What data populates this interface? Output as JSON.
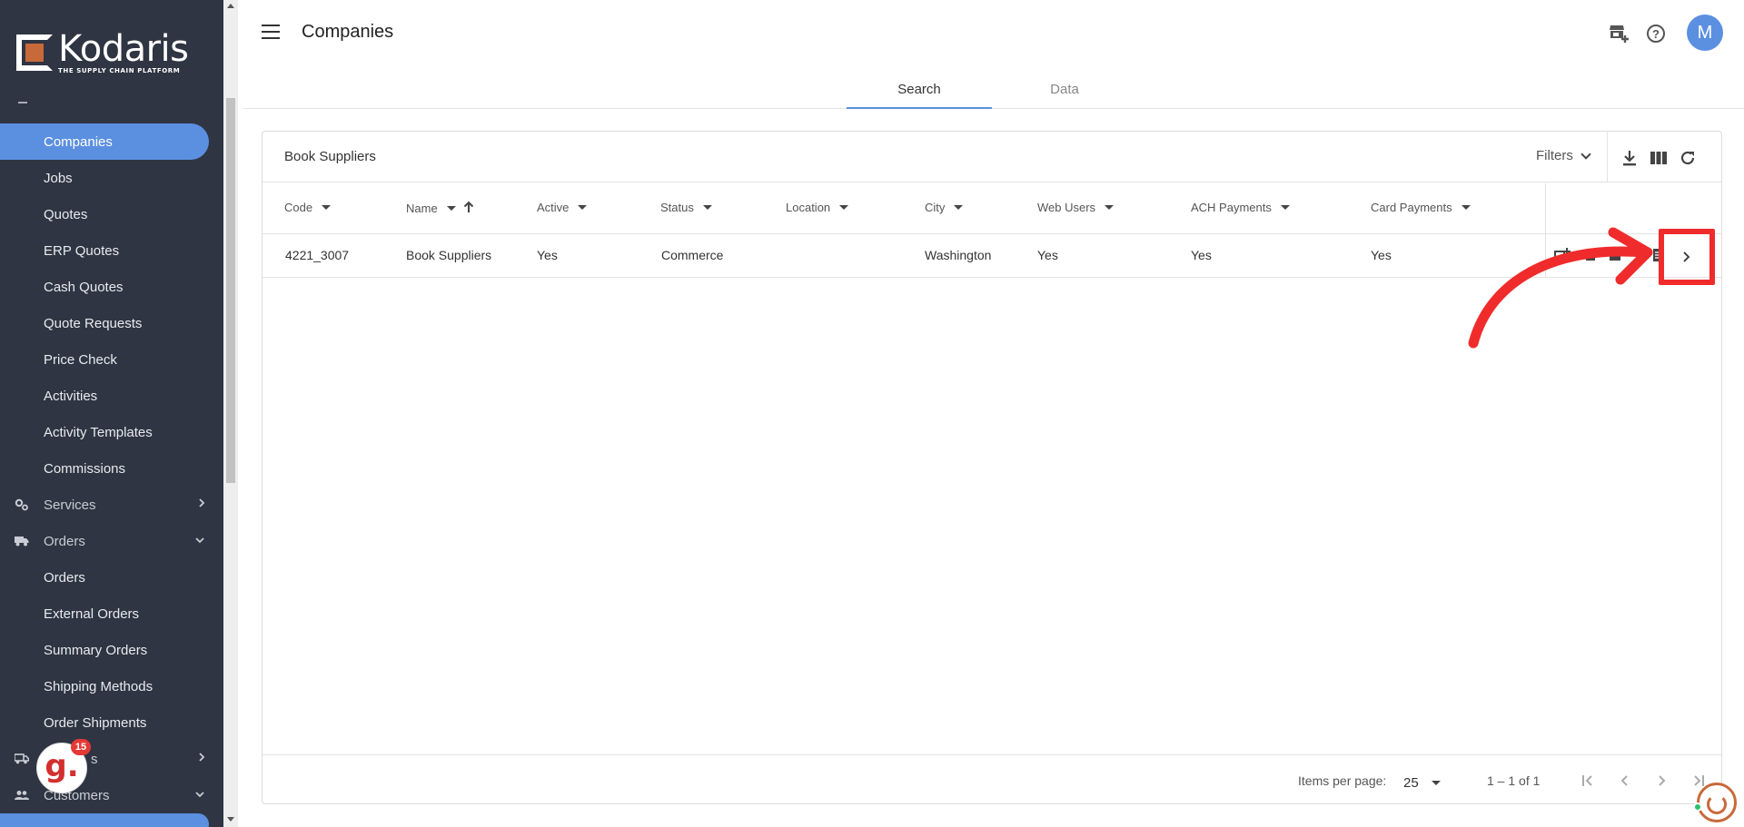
{
  "brand": {
    "name": "Kodaris",
    "tagline": "THE SUPPLY CHAIN PLATFORM"
  },
  "sidebar": {
    "items": [
      {
        "label": "Companies",
        "active": true
      },
      {
        "label": "Jobs"
      },
      {
        "label": "Quotes"
      },
      {
        "label": "ERP Quotes"
      },
      {
        "label": "Cash Quotes"
      },
      {
        "label": "Quote Requests"
      },
      {
        "label": "Price Check"
      },
      {
        "label": "Activities"
      },
      {
        "label": "Activity Templates"
      },
      {
        "label": "Commissions"
      }
    ],
    "services_group": {
      "label": "Services",
      "icon": "gears-icon"
    },
    "orders_group": {
      "label": "Orders",
      "icon": "truck-icon"
    },
    "orders_items": [
      {
        "label": "Orders"
      },
      {
        "label": "External Orders"
      },
      {
        "label": "Summary Orders"
      },
      {
        "label": "Shipping Methods"
      },
      {
        "label": "Order Shipments"
      }
    ],
    "partial_group": {
      "label": "s",
      "icon": "truck-icon"
    },
    "customers_group": {
      "label": "Customers",
      "icon": "people-icon"
    }
  },
  "header": {
    "title": "Companies",
    "avatar_initial": "M",
    "tabs": [
      {
        "label": "Search",
        "active": true
      },
      {
        "label": "Data",
        "active": false
      }
    ]
  },
  "card": {
    "title": "Book Suppliers",
    "filters_label": "Filters"
  },
  "table": {
    "columns": [
      "Code",
      "Name",
      "Active",
      "Status",
      "Location",
      "City",
      "Web Users",
      "ACH Payments",
      "Card Payments"
    ],
    "sorted_column": "Name",
    "rows": [
      {
        "code": "4221_3007",
        "name": "Book Suppliers",
        "active": "Yes",
        "status": "Commerce",
        "location": "",
        "city": "Washington",
        "web_users": "Yes",
        "ach_payments": "Yes",
        "card_payments": "Yes"
      }
    ]
  },
  "paginator": {
    "items_per_page_label": "Items per page:",
    "items_per_page": "25",
    "range_label": "1 – 1 of 1"
  },
  "widgets": {
    "notification_count": "15"
  },
  "colors": {
    "sidebar_bg": "#2f3542",
    "accent": "#5b8fe0",
    "annotation_red": "#f02b2b",
    "brand_orange": "#c8693a"
  }
}
